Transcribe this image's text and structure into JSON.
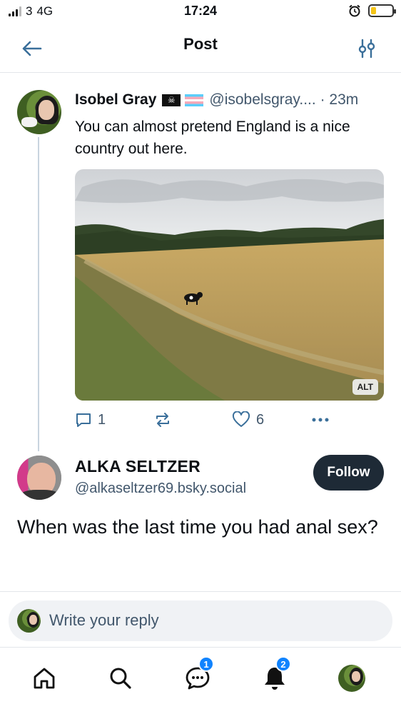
{
  "status_bar": {
    "carrier": "3",
    "network": "4G",
    "time": "17:24",
    "battery_level": 0.25,
    "battery_color": "#f5c518"
  },
  "header": {
    "title": "Post",
    "back_icon": "arrow-left-icon",
    "filter_icon": "sliders-icon"
  },
  "post": {
    "author_name": "Isobel Gray",
    "author_flags": [
      "pirate-flag",
      "transgender-flag"
    ],
    "handle": "@isobelsgray....",
    "separator": "·",
    "time": "23m",
    "text": "You can almost pretend England is a nice country out here.",
    "image_alt_badge": "ALT",
    "actions": {
      "replies": "1",
      "reposts": "",
      "likes": "6",
      "reply_icon": "speech-bubble-icon",
      "repost_icon": "repost-icon",
      "like_icon": "heart-icon",
      "more_icon": "ellipsis-icon"
    }
  },
  "reply": {
    "author_name": "ALKA SELTZER",
    "handle": "@alkaseltzer69.bsky.social",
    "follow_label": "Follow",
    "text": "When was the last time you had anal sex?"
  },
  "composer": {
    "placeholder": "Write your reply"
  },
  "nav": {
    "items": [
      {
        "icon": "home-icon",
        "badge": ""
      },
      {
        "icon": "search-icon",
        "badge": ""
      },
      {
        "icon": "chat-icon",
        "badge": "1"
      },
      {
        "icon": "bell-icon",
        "badge": "2"
      },
      {
        "icon": "profile-avatar",
        "badge": ""
      }
    ]
  },
  "colors": {
    "accent": "#1083fe",
    "secondary_text": "#42576c",
    "follow_bg": "#1e2a36"
  }
}
